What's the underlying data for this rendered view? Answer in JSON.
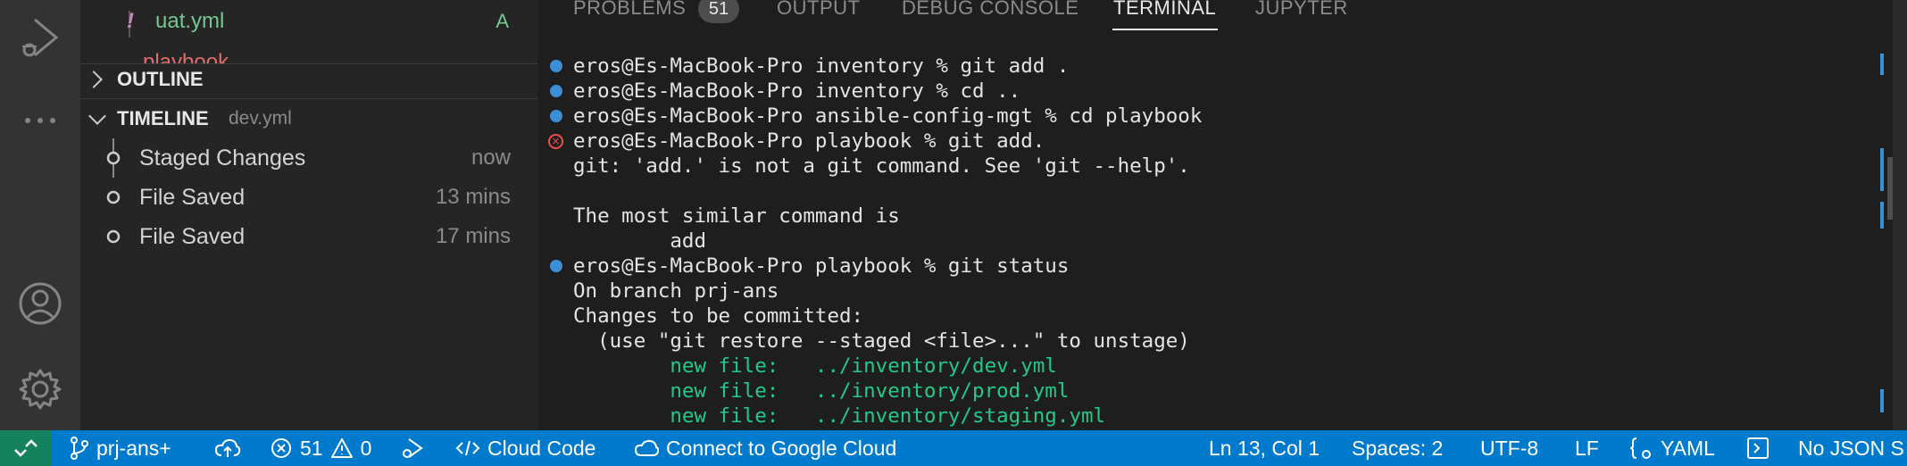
{
  "sidebar": {
    "explorer_partial": {
      "file_name": "uat.yml",
      "file_status": "A",
      "folder_cut": "playbook"
    },
    "outline": {
      "title": "OUTLINE"
    },
    "timeline": {
      "title": "TIMELINE",
      "file": "dev.yml",
      "items": [
        {
          "label": "Staged Changes",
          "time": "now"
        },
        {
          "label": "File Saved",
          "time": "13 mins"
        },
        {
          "label": "File Saved",
          "time": "17 mins"
        }
      ]
    }
  },
  "panel": {
    "tabs": [
      {
        "label": "PROBLEMS",
        "active": false
      },
      {
        "label": "OUTPUT",
        "active": false
      },
      {
        "label": "DEBUG CONSOLE",
        "active": false
      },
      {
        "label": "TERMINAL",
        "active": true
      },
      {
        "label": "JUPYTER",
        "active": false
      }
    ],
    "problems_badge": "51"
  },
  "terminal": {
    "lines": [
      {
        "text": "eros@Es-MacBook-Pro inventory % git add .",
        "marker": "ok"
      },
      {
        "text": "eros@Es-MacBook-Pro inventory % cd ..",
        "marker": "ok"
      },
      {
        "text": "eros@Es-MacBook-Pro ansible-config-mgt % cd playbook",
        "marker": "ok"
      },
      {
        "text": "eros@Es-MacBook-Pro playbook % git add.",
        "marker": "error"
      },
      {
        "text": "git: 'add.' is not a git command. See 'git --help'.",
        "marker": ""
      },
      {
        "text": "",
        "marker": ""
      },
      {
        "text": "The most similar command is",
        "marker": ""
      },
      {
        "text": "        add",
        "marker": ""
      },
      {
        "text": "eros@Es-MacBook-Pro playbook % git status",
        "marker": "ok"
      },
      {
        "text": "On branch prj-ans",
        "marker": ""
      },
      {
        "text": "Changes to be committed:",
        "marker": ""
      },
      {
        "text": "  (use \"git restore --staged <file>...\" to unstage)",
        "marker": ""
      },
      {
        "text": "        new file:   ../inventory/dev.yml",
        "marker": "",
        "color": "green"
      },
      {
        "text": "        new file:   ../inventory/prod.yml",
        "marker": "",
        "color": "green"
      },
      {
        "text": "        new file:   ../inventory/staging.yml",
        "marker": "",
        "color": "green"
      }
    ]
  },
  "status": {
    "branch": "prj-ans+",
    "errors": "51",
    "warnings": "0",
    "cloud_code": "Cloud Code",
    "connect_cloud": "Connect to Google Cloud",
    "cursor": "Ln 13, Col 1",
    "spaces": "Spaces: 2",
    "encoding": "UTF-8",
    "eol": "LF",
    "language": "YAML",
    "json_schema": "No JSON S"
  },
  "colors": {
    "status_bar": "#007acc",
    "remote_indicator": "#16825d",
    "terminal_green": "#23c98a",
    "error_red": "#f14c4c",
    "dot_blue": "#3a8fd6"
  }
}
